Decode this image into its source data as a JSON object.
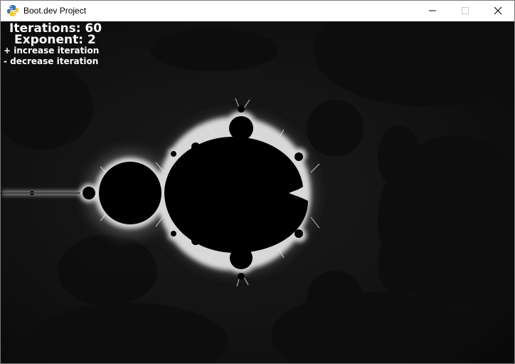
{
  "window": {
    "title": "Boot.dev Project",
    "icons": {
      "app": "python-icon",
      "minimize": "minimize-icon",
      "maximize": "maximize-icon",
      "close": "close-icon"
    }
  },
  "overlay": {
    "iterations_label": "Iterations: 60",
    "exponent_label": "Exponent: 2",
    "increase_hint": "+ increase iteration",
    "decrease_hint": "- decrease iteration"
  },
  "fractal": {
    "name": "mandelbrot-set",
    "background": "#000000",
    "glow_color": "#ffffff",
    "body_color": "#000000"
  }
}
